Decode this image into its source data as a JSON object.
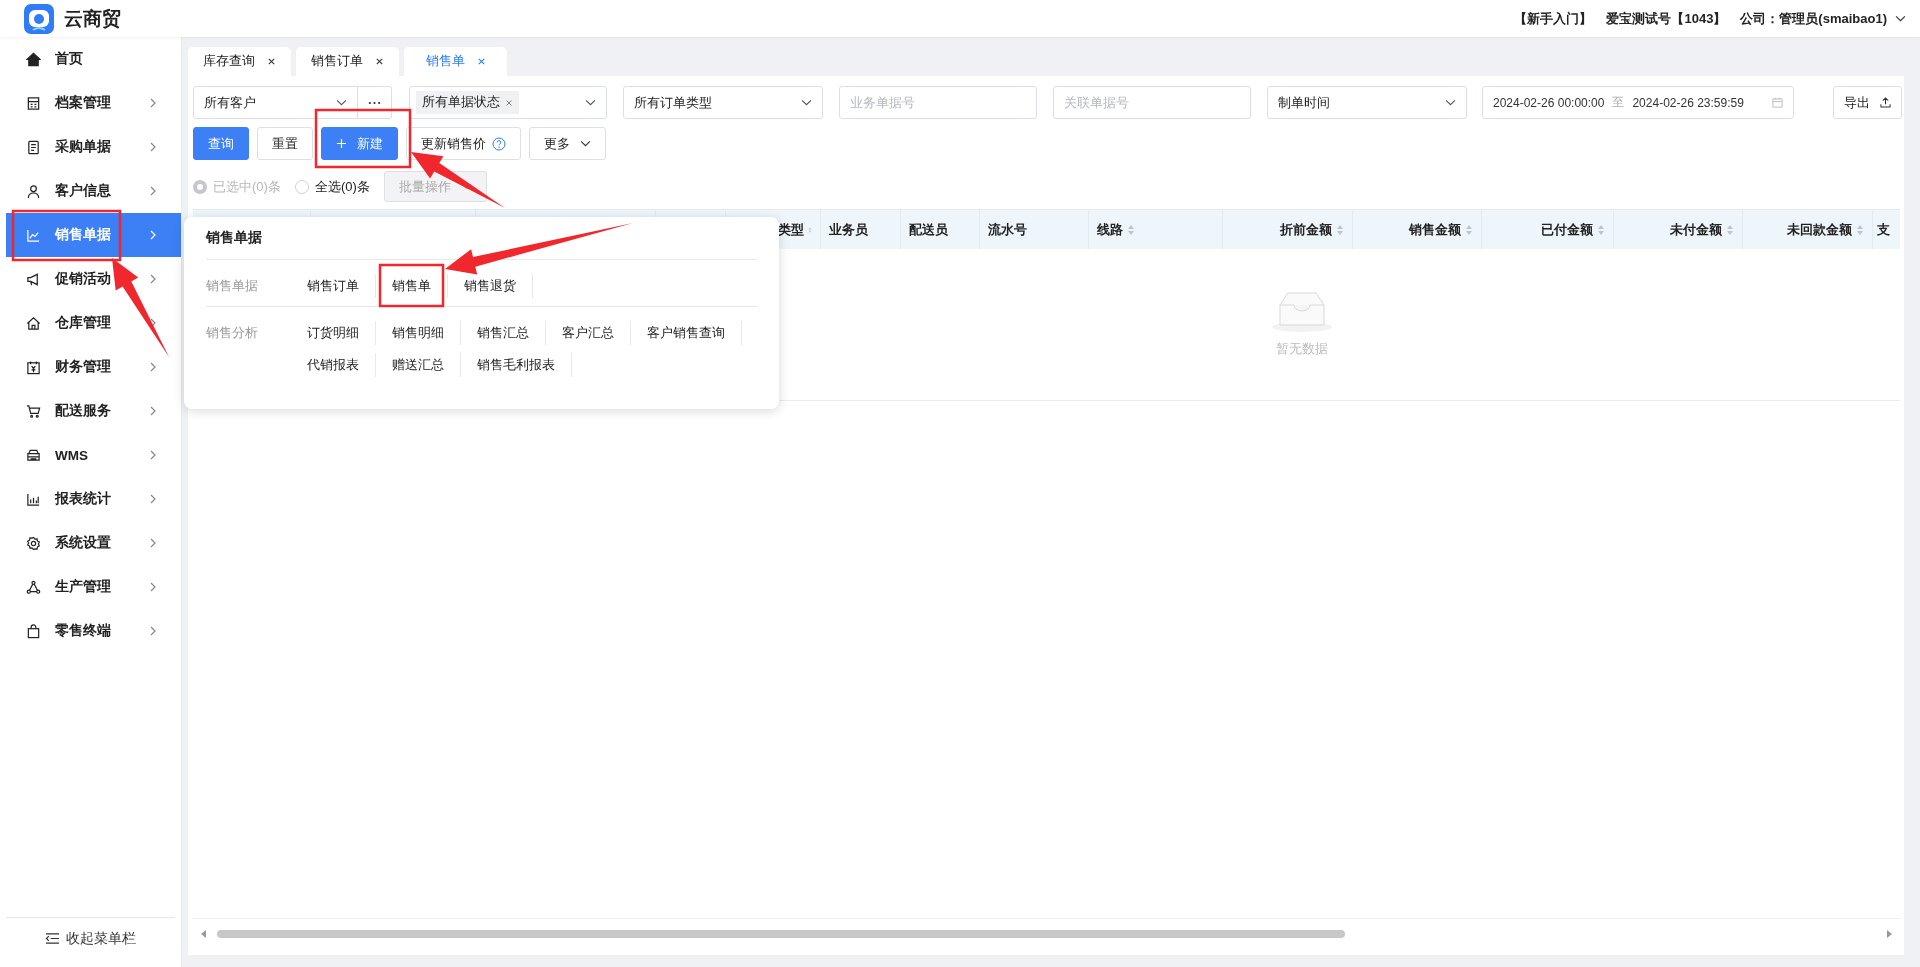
{
  "app": {
    "title": "云商贸"
  },
  "header": {
    "guide": "【新手入门】",
    "account": "爱宝测试号【1043】",
    "company": "公司：管理员(smaibao1)"
  },
  "sidebar": {
    "items": [
      {
        "label": "首页",
        "selected": false,
        "has_submenu": false
      },
      {
        "label": "档案管理",
        "selected": false,
        "has_submenu": true
      },
      {
        "label": "采购单据",
        "selected": false,
        "has_submenu": true
      },
      {
        "label": "客户信息",
        "selected": false,
        "has_submenu": true
      },
      {
        "label": "销售单据",
        "selected": true,
        "has_submenu": true
      },
      {
        "label": "促销活动",
        "selected": false,
        "has_submenu": true
      },
      {
        "label": "仓库管理",
        "selected": false,
        "has_submenu": true
      },
      {
        "label": "财务管理",
        "selected": false,
        "has_submenu": true
      },
      {
        "label": "配送服务",
        "selected": false,
        "has_submenu": true
      },
      {
        "label": "WMS",
        "selected": false,
        "has_submenu": true
      },
      {
        "label": "报表统计",
        "selected": false,
        "has_submenu": true
      },
      {
        "label": "系统设置",
        "selected": false,
        "has_submenu": true
      },
      {
        "label": "生产管理",
        "selected": false,
        "has_submenu": true
      },
      {
        "label": "零售终端",
        "selected": false,
        "has_submenu": true
      }
    ],
    "collapse": "收起菜单栏"
  },
  "tabs": [
    {
      "label": "库存查询",
      "selected": false
    },
    {
      "label": "销售订单",
      "selected": false
    },
    {
      "label": "销售单",
      "selected": true
    }
  ],
  "filters": {
    "customer": "所有客户",
    "status_tag": "所有单据状态",
    "order_type": "所有订单类型",
    "doc_no_placeholder": "业务单据号",
    "related_no_placeholder": "关联单据号",
    "time_type": "制单时间",
    "date_start": "2024-02-26 00:00:00",
    "date_separator": "至",
    "date_end": "2024-02-26 23:59:59",
    "export": "导出"
  },
  "actions": [
    {
      "label": "查询",
      "kind": "primary"
    },
    {
      "label": "重置",
      "kind": "default"
    },
    {
      "label": "新建",
      "kind": "create"
    },
    {
      "label": "更新销售价",
      "kind": "help"
    },
    {
      "label": "更多",
      "kind": "dropdown"
    }
  ],
  "selection": {
    "options": [
      {
        "label": "已选中(0)条",
        "selected": true,
        "disabled": true
      },
      {
        "label": "全选(0)条",
        "selected": false,
        "disabled": false
      }
    ],
    "batch": {
      "label": "批量操作",
      "disabled": true
    }
  },
  "table": {
    "columns": [
      {
        "label": "类型",
        "sortable": true,
        "numeric": false
      },
      {
        "label": "业务员",
        "sortable": false,
        "numeric": false
      },
      {
        "label": "配送员",
        "sortable": false,
        "numeric": false
      },
      {
        "label": "流水号",
        "sortable": false,
        "numeric": false
      },
      {
        "label": "线路",
        "sortable": true,
        "numeric": false
      },
      {
        "label": "折前金额",
        "sortable": true,
        "numeric": true
      },
      {
        "label": "销售金额",
        "sortable": true,
        "numeric": true
      },
      {
        "label": "已付金额",
        "sortable": true,
        "numeric": true
      },
      {
        "label": "未付金额",
        "sortable": true,
        "numeric": true
      },
      {
        "label": "未回款金额",
        "sortable": true,
        "numeric": true
      },
      {
        "label": "支"
      }
    ],
    "empty_text": "暂无数据"
  },
  "popup": {
    "title": "销售单据",
    "groups": [
      {
        "label": "销售单据",
        "links": [
          "销售订单",
          "销售单",
          "销售退货"
        ]
      },
      {
        "label": "销售分析",
        "links": [
          "订货明细",
          "销售明细",
          "销售汇总",
          "客户汇总",
          "客户销售查询",
          "代销报表",
          "赠送汇总",
          "销售毛利报表"
        ]
      }
    ]
  }
}
